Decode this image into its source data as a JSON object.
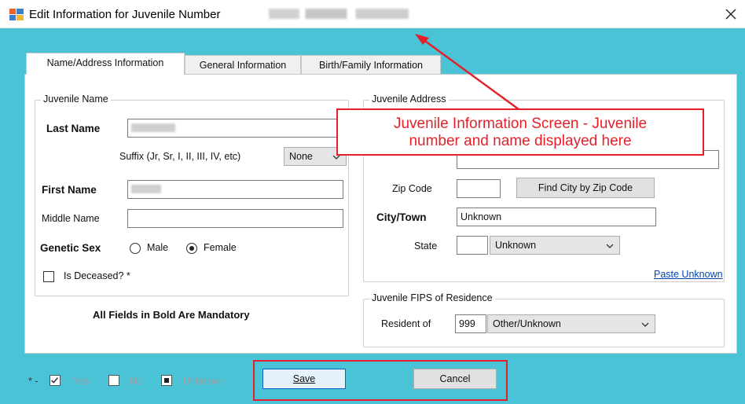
{
  "window": {
    "title": "Edit Information for Juvenile Number",
    "title_icon": "form-window-icon",
    "close_icon": "close-icon"
  },
  "tabs": [
    {
      "label": "Name/Address Information",
      "active": true
    },
    {
      "label": "General Information",
      "active": false
    },
    {
      "label": "Birth/Family Information",
      "active": false
    }
  ],
  "juvenile_name": {
    "legend": "Juvenile Name",
    "last_name_label": "Last Name",
    "suffix_label": "Suffix (Jr, Sr, I, II, III, IV, etc)",
    "suffix_value": "None",
    "first_name_label": "First Name",
    "middle_name_label": "Middle Name",
    "genetic_sex_label": "Genetic Sex",
    "sex_options": [
      "Male",
      "Female"
    ],
    "sex_selected": "Female",
    "deceased_label": "Is Deceased? *"
  },
  "mandatory_note": "All Fields in Bold Are Mandatory",
  "juvenile_address": {
    "legend": "Juvenile Address",
    "zip_label": "Zip Code",
    "zip_value": "",
    "find_city_button": "Find City by Zip Code",
    "city_label": "City/Town",
    "city_value": "Unknown",
    "state_label": "State",
    "state_code": "",
    "state_value": "Unknown",
    "paste_unknown_link": "Paste Unknown"
  },
  "fips": {
    "legend": "Juvenile FIPS of Residence",
    "resident_label": "Resident of",
    "code": "999",
    "value": "Other/Unknown"
  },
  "callout": {
    "line1": "Juvenile Information Screen - Juvenile",
    "line2": "number and name displayed here",
    "color": "#e5202a"
  },
  "legend_bar": {
    "prefix": "* -",
    "yes_label": "Yes",
    "no_label": "No",
    "unknown_label": "Unknown"
  },
  "buttons": {
    "save": "Save",
    "cancel": "Cancel"
  },
  "colors": {
    "background": "#4bc3d6",
    "accent_red": "#e5202a",
    "link": "#0645ad"
  }
}
